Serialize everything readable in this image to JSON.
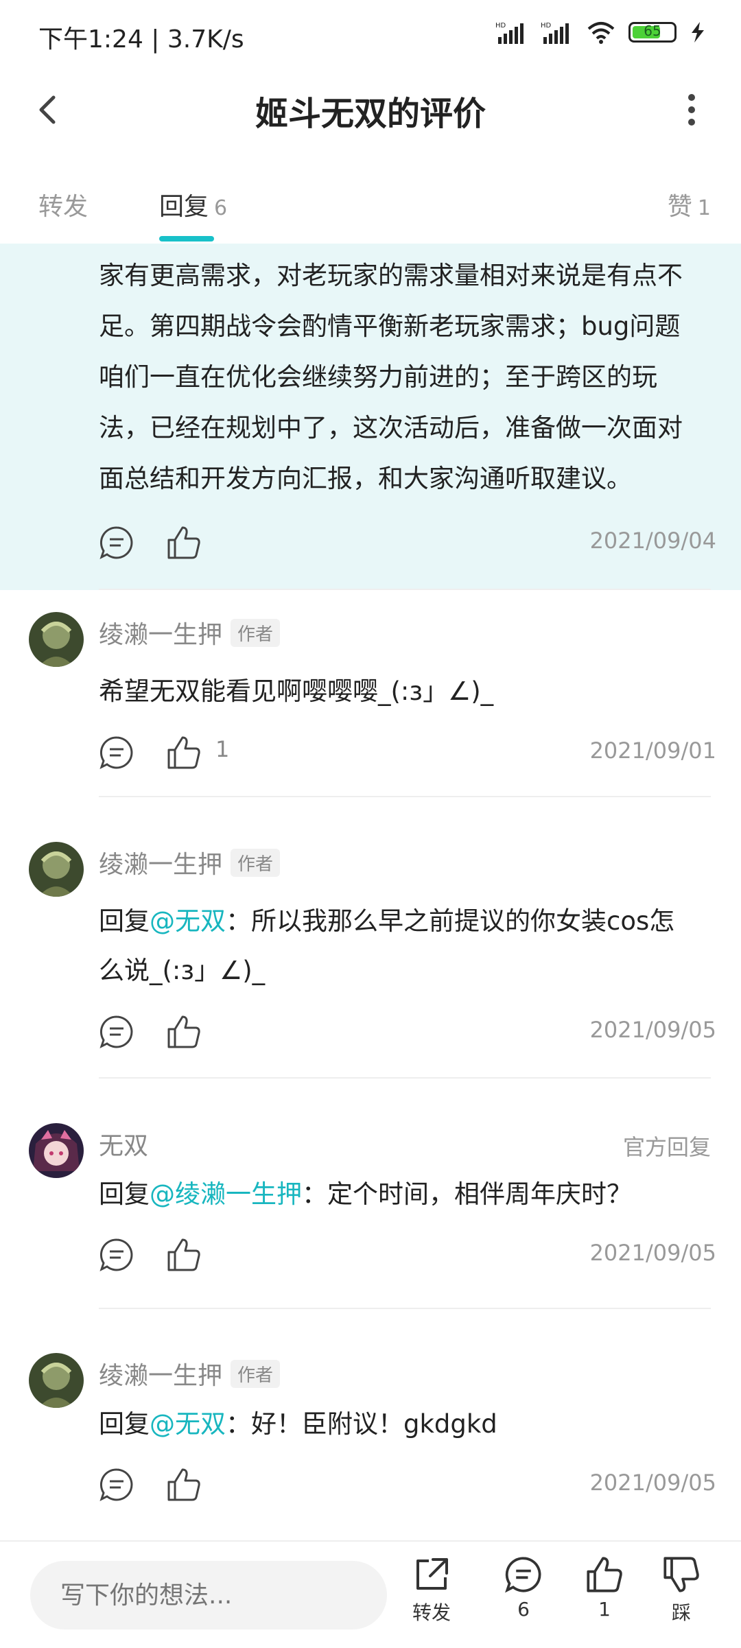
{
  "status": {
    "time": "下午1:24 | 3.7K/s",
    "battery": "65"
  },
  "header": {
    "title": "姬斗无双的评价"
  },
  "tabs": {
    "repost": "转发",
    "reply": "回复",
    "reply_count": "6",
    "like": "赞",
    "like_count": "1"
  },
  "highlight_reply": {
    "lines": [
      "家有更高需求，对老玩家的需求量相对来说是有点不",
      "足。第四期战令会酌情平衡新老玩家需求；bug问题",
      "咱们一直在优化会继续努力前进的；至于跨区的玩",
      "法，已经在规划中了，这次活动后，准备做一次面对",
      "面总结和开发方向汇报，和大家沟通听取建议。"
    ],
    "date": "2021/09/04"
  },
  "replies": [
    {
      "name": "绫濑一生押",
      "badge": "作者",
      "prefix": "",
      "mention": "",
      "text_lines": [
        "希望无双能看见啊嘤嘤嘤_(:з」∠)_"
      ],
      "likes": "1",
      "date": "2021/09/01"
    },
    {
      "name": "绫濑一生押",
      "badge": "作者",
      "prefix": "回复",
      "mention": "@无双",
      "text_lines": [
        "：所以我那么早之前提议的你女装cos怎",
        "么说_(:з」∠)_"
      ],
      "likes": "",
      "date": "2021/09/05"
    },
    {
      "name": "无双",
      "official": "官方回复",
      "prefix": "回复",
      "mention": "@绫濑一生押",
      "text_lines": [
        "：定个时间，相伴周年庆时？"
      ],
      "likes": "",
      "date": "2021/09/05"
    },
    {
      "name": "绫濑一生押",
      "badge": "作者",
      "prefix": "回复",
      "mention": "@无双",
      "text_lines": [
        "：好！臣附议！gkdgkd"
      ],
      "likes": "",
      "date": "2021/09/05"
    }
  ],
  "bottom": {
    "placeholder": "写下你的想法...",
    "repost_label": "转发",
    "comment_count": "6",
    "like_count": "1",
    "dislike_label": "踩"
  },
  "colors": {
    "accent": "#18c1c9",
    "mention": "#18b6bf",
    "highlight_bg": "#e8f7f8"
  }
}
